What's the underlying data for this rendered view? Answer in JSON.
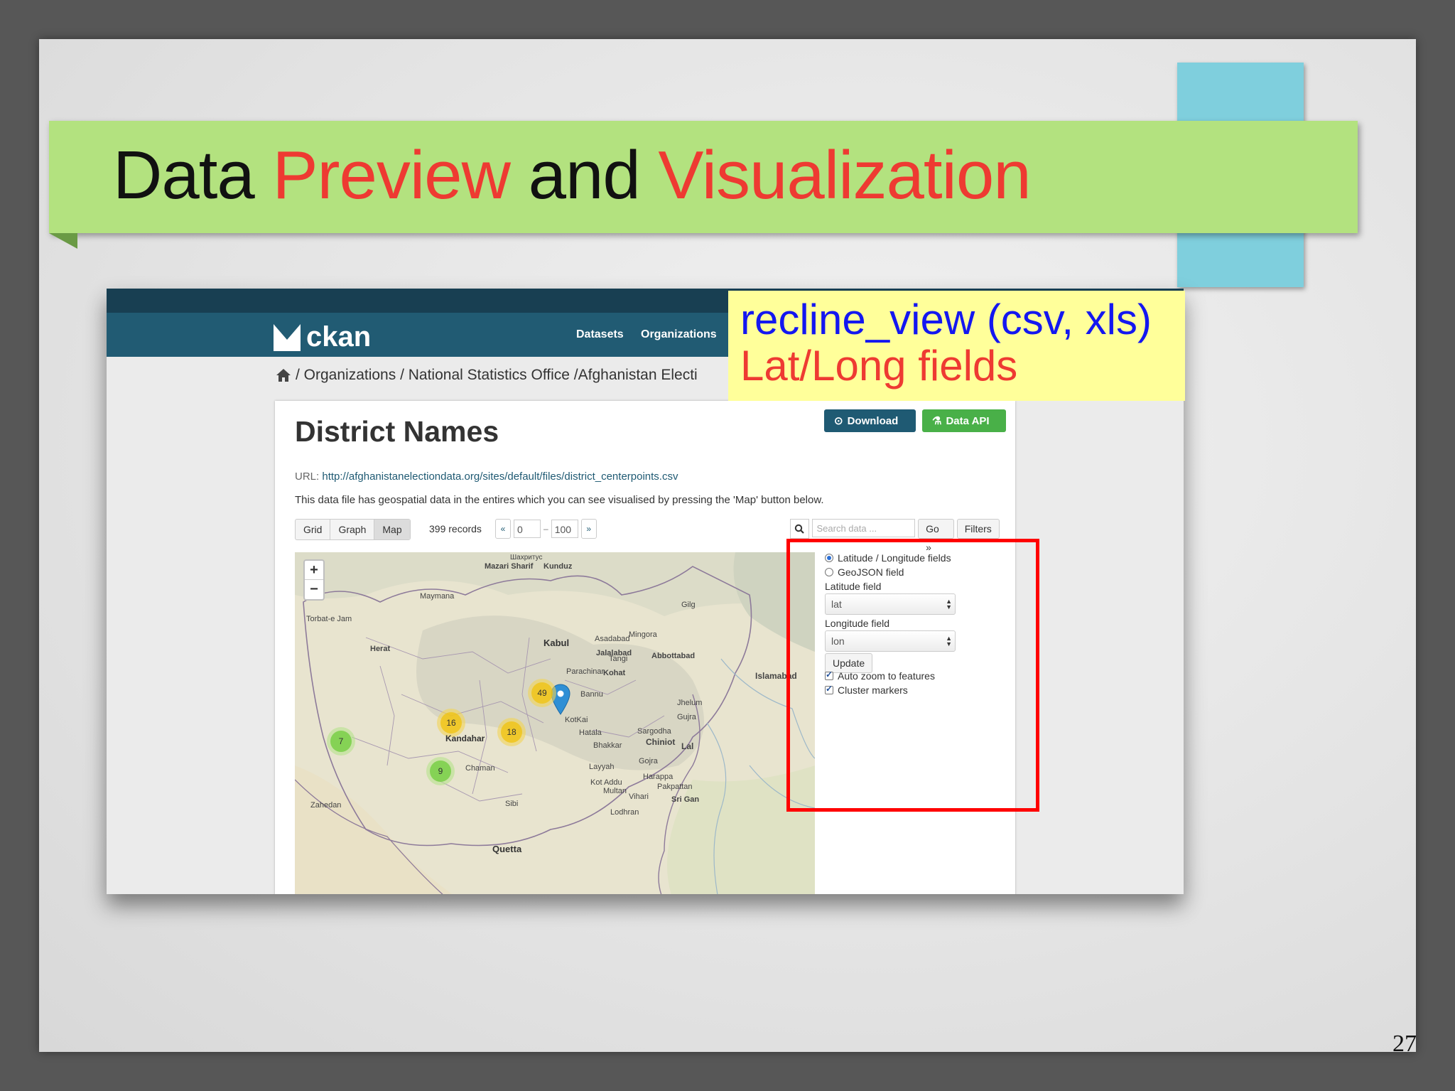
{
  "slide": {
    "title": {
      "part1": "Data",
      "part2": "Preview",
      "part3": "and",
      "part4": "Visualization"
    },
    "page_number": "27",
    "note": {
      "line1": "recline_view (csv, xls)",
      "line2": "Lat/Long fields"
    },
    "colors": {
      "title_band": "#b3e27f",
      "accent_red": "#ee3a32",
      "note_blue": "#1417f0",
      "note_bg": "#ffff9a",
      "highlight_box": "#ff0000"
    }
  },
  "ckan": {
    "logo_text": "ckan",
    "nav": [
      "Datasets",
      "Organizations"
    ],
    "breadcrumb": "/ Organizations / National Statistics Office /Afghanistan Electi",
    "resource": {
      "title": "District Names",
      "url_label": "URL:",
      "url": "http://afghanistanelectiondata.org/sites/default/files/district_centerpoints.csv",
      "description": "This data file has geospatial data in the entires which you can see visualised by pressing the 'Map' button below.",
      "download_label": "Download",
      "api_label": "Data API"
    },
    "toolbar": {
      "views": [
        "Grid",
        "Graph",
        "Map"
      ],
      "active_view": "Map",
      "records": "399 records",
      "prev": "«",
      "next": "»",
      "from": "0",
      "to": "100",
      "search_placeholder": "Search data ...",
      "go_label": "Go »",
      "filters_label": "Filters"
    },
    "map": {
      "zoom_in": "+",
      "zoom_out": "−",
      "clusters": [
        "49",
        "16",
        "18",
        "7",
        "9"
      ],
      "places": {
        "kabul": "Kabul",
        "kandahar": "Kandahar",
        "quetta": "Quetta",
        "herat": "Herat",
        "islamabad": "Islamabad",
        "mazar": "Mazari Sharif",
        "kunduz": "Kunduz",
        "maymana": "Maymana",
        "torbat": "Torbat-e Jam",
        "jalalabad": "Jalalabad",
        "abbottabad": "Abbottabad",
        "kohat": "Kohat",
        "chaman": "Chaman",
        "zahedan": "Zahedan",
        "bannu": "Bannu",
        "sargodha": "Sargodha",
        "chiniot": "Chiniot",
        "sibi": "Sibi",
        "multan": "Multan",
        "mingora": "Mingora",
        "asadabad": "Asadabad",
        "parachinar": "Parachinar",
        "hatala": "Hatala",
        "bhakkar": "Bhakkar",
        "layyah": "Layyah",
        "kot_addu": "Kot Addu",
        "harappa": "Harappa",
        "pakpattan": "Pakpattan",
        "vihari": "Vihari",
        "sri_gan": "Sri Gan",
        "lodhran": "Lodhran",
        "gojra": "Gojra",
        "tangi": "Tangi",
        "kotkai": "KotKai",
        "shakhrytus": "Шахритус",
        "gilg": "Gilg",
        "jhelum": "Jhelum",
        "gujrat": "Gujra",
        "la": "Lal"
      }
    },
    "settings": {
      "radio_latlon": "Latitude / Longitude fields",
      "radio_geojson": "GeoJSON field",
      "lat_label": "Latitude field",
      "lat_value": "lat",
      "lon_label": "Longitude field",
      "lon_value": "lon",
      "update_label": "Update",
      "auto_zoom": "Auto zoom to features",
      "cluster": "Cluster markers"
    }
  }
}
